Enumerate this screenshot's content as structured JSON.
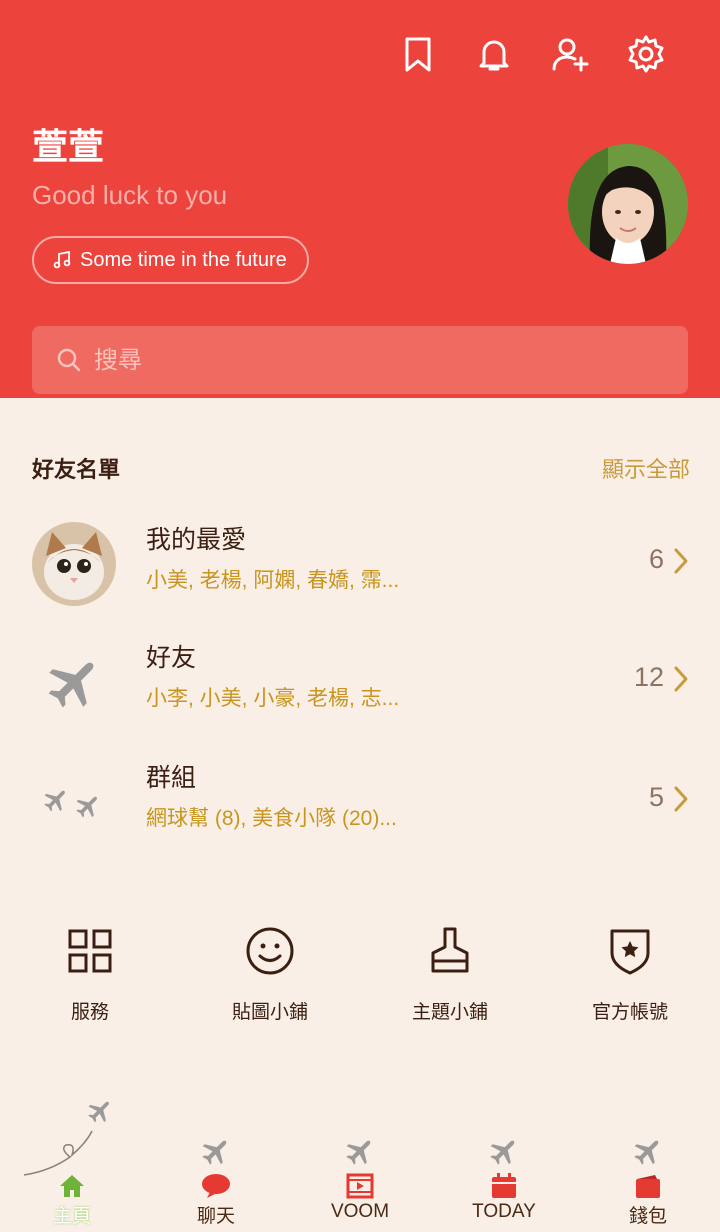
{
  "header": {
    "profile_name": "萱萱",
    "status_message": "Good luck to you",
    "music": "Some time in the future",
    "search_placeholder": "搜尋",
    "accent_color": "#ec433d",
    "top_icons": [
      "bookmark-icon",
      "bell-icon",
      "add-friend-icon",
      "settings-icon"
    ]
  },
  "friends_section": {
    "title": "好友名單",
    "show_all": "顯示全部",
    "rows": [
      {
        "title": "我的最愛",
        "subtitle": "小美, 老楊, 阿嫻, 春嬌, 霈...",
        "count": "6"
      },
      {
        "title": "好友",
        "subtitle": "小李, 小美, 小豪, 老楊, 志...",
        "count": "12"
      },
      {
        "title": "群組",
        "subtitle": "網球幫 (8), 美食小隊 (20)...",
        "count": "5"
      }
    ]
  },
  "services": [
    {
      "label": "服務",
      "icon": "grid-icon"
    },
    {
      "label": "貼圖小鋪",
      "icon": "smiley-icon"
    },
    {
      "label": "主題小鋪",
      "icon": "brush-icon"
    },
    {
      "label": "官方帳號",
      "icon": "shield-star-icon"
    }
  ],
  "tabbar": [
    {
      "label": "主頁",
      "icon": "home-icon",
      "active": true
    },
    {
      "label": "聊天",
      "icon": "chat-icon"
    },
    {
      "label": "VOOM",
      "icon": "voom-icon"
    },
    {
      "label": "TODAY",
      "icon": "calendar-icon"
    },
    {
      "label": "錢包",
      "icon": "wallet-icon"
    }
  ]
}
